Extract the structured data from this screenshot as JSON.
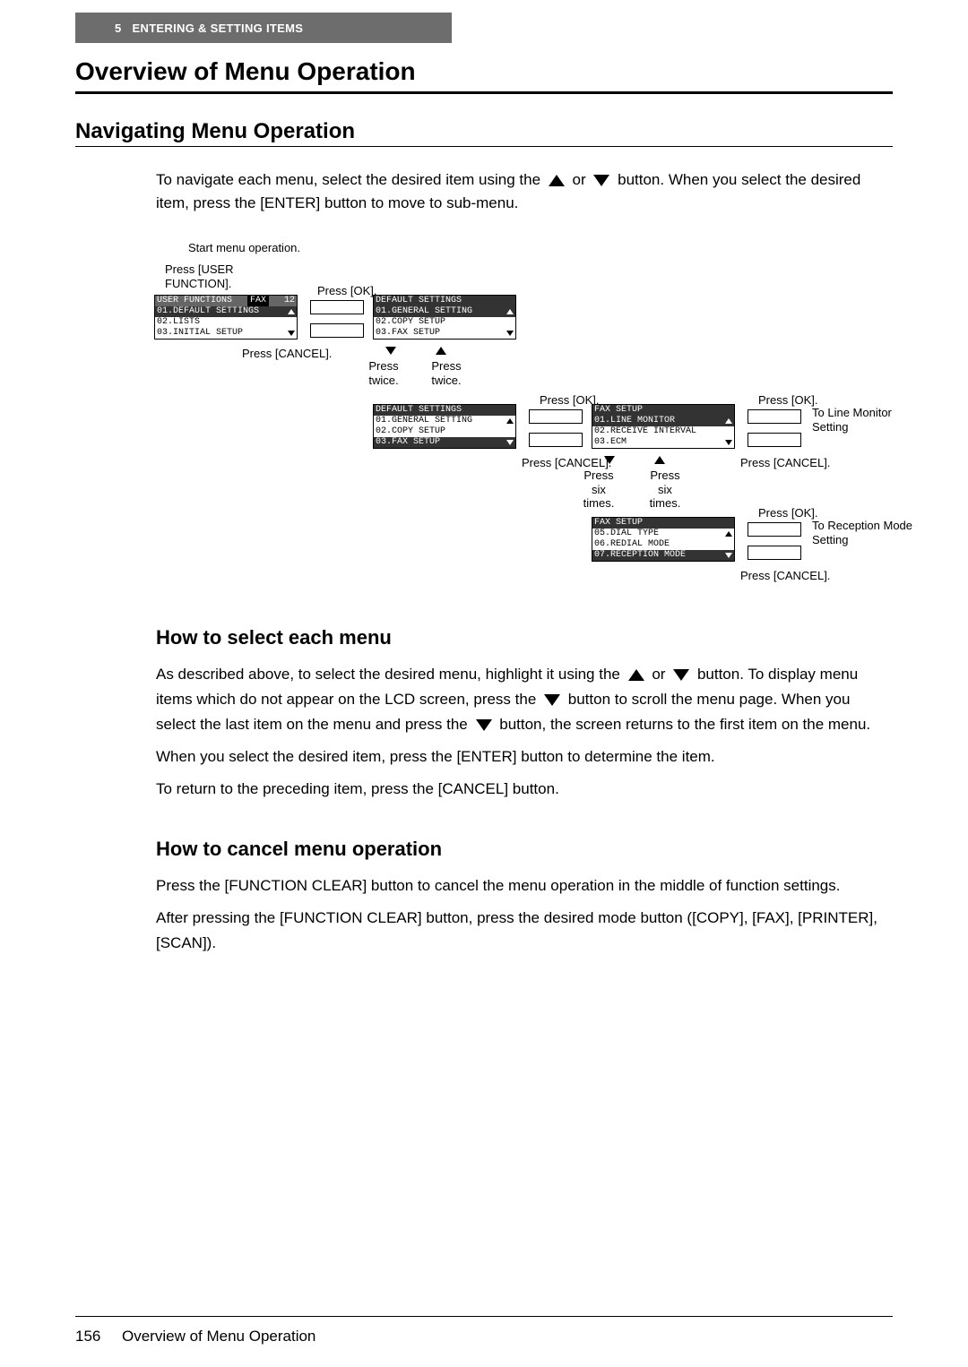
{
  "header": {
    "chapter_num": "5",
    "chapter_title": "ENTERING & SETTING ITEMS"
  },
  "main_title": "Overview of Menu Operation",
  "sub_title": "Navigating Menu Operation",
  "intro_before": "To navigate each menu, select the desired item using the",
  "intro_mid": "or",
  "intro_after": "button. When you select the desired item, press the [ENTER] button to move to sub-menu.",
  "flow": {
    "start": "Start menu operation.",
    "press_user_func": "Press [USER FUNCTION].",
    "press_ok": "Press [OK].",
    "press_cancel": "Press [CANCEL].",
    "press_twice": "Press twice.",
    "press_six": "Press six times.",
    "to_line_monitor": "To Line Monitor Setting",
    "to_reception": "To Reception Mode Setting"
  },
  "lcd1": {
    "title_left": "USER FUNCTIONS",
    "title_mid": "FAX",
    "title_right": "12",
    "row1": "01.DEFAULT SETTINGS",
    "row2": "02.LISTS",
    "row3": "03.INITIAL SETUP"
  },
  "lcd2": {
    "title": "DEFAULT SETTINGS",
    "row1": "01.GENERAL SETTING",
    "row2": "02.COPY SETUP",
    "row3": "03.FAX SETUP"
  },
  "lcd3": {
    "title": "DEFAULT SETTINGS",
    "row1": "01.GENERAL SETTING",
    "row2": "02.COPY SETUP",
    "row3": "03.FAX SETUP"
  },
  "lcd4": {
    "title": "FAX SETUP",
    "row1": "01.LINE MONITOR",
    "row2": "02.RECEIVE INTERVAL",
    "row3": "03.ECM"
  },
  "lcd5": {
    "title": "FAX SETUP",
    "row1": "05.DIAL TYPE",
    "row2": "06.REDIAL MODE",
    "row3": "07.RECEPTION MODE"
  },
  "select_title": "How to select each menu",
  "select_p1a": "As described above, to select the desired menu, highlight it using the",
  "select_p1b": "or",
  "select_p1c": "button. To display menu items which do not appear on the LCD screen, press the",
  "select_p1d": "button to scroll the menu page. When you select the last item on the menu and press the",
  "select_p1e": "button, the screen returns to the first item on the menu.",
  "select_p2": "When you select the desired item, press the [ENTER] button to determine the item.",
  "select_p3": "To return to the preceding item, press the [CANCEL] button.",
  "cancel_title": "How to cancel menu operation",
  "cancel_p1": "Press the [FUNCTION CLEAR] button to cancel the menu operation in the middle of function settings.",
  "cancel_p2": "After pressing the [FUNCTION CLEAR] button, press the desired mode button ([COPY], [FAX], [PRINTER], [SCAN]).",
  "footer": {
    "page_num": "156",
    "section": "Overview of Menu Operation"
  }
}
